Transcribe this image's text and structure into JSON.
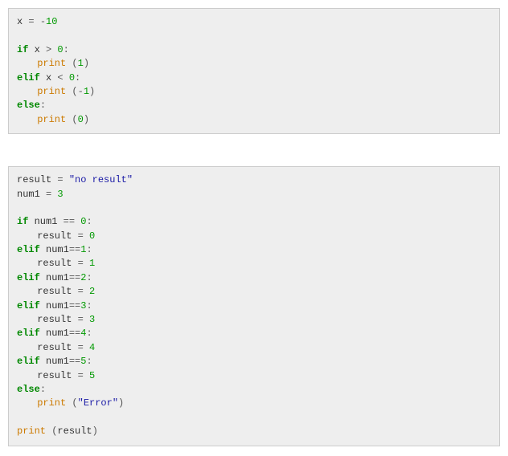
{
  "blocks": [
    {
      "lines": [
        [
          {
            "t": "name",
            "v": "x"
          },
          {
            "t": "txt",
            "v": " "
          },
          {
            "t": "op",
            "v": "="
          },
          {
            "t": "txt",
            "v": " "
          },
          {
            "t": "op",
            "v": "-"
          },
          {
            "t": "num",
            "v": "10"
          }
        ],
        [],
        [
          {
            "t": "kw",
            "v": "if"
          },
          {
            "t": "txt",
            "v": " "
          },
          {
            "t": "name",
            "v": "x"
          },
          {
            "t": "txt",
            "v": " "
          },
          {
            "t": "op",
            "v": ">"
          },
          {
            "t": "txt",
            "v": " "
          },
          {
            "t": "num",
            "v": "0"
          },
          {
            "t": "op",
            "v": ":"
          }
        ],
        [
          {
            "t": "indent"
          },
          {
            "t": "func",
            "v": "print"
          },
          {
            "t": "txt",
            "v": " "
          },
          {
            "t": "op",
            "v": "("
          },
          {
            "t": "num",
            "v": "1"
          },
          {
            "t": "op",
            "v": ")"
          }
        ],
        [
          {
            "t": "kw",
            "v": "elif"
          },
          {
            "t": "txt",
            "v": " "
          },
          {
            "t": "name",
            "v": "x"
          },
          {
            "t": "txt",
            "v": " "
          },
          {
            "t": "op",
            "v": "<"
          },
          {
            "t": "txt",
            "v": " "
          },
          {
            "t": "num",
            "v": "0"
          },
          {
            "t": "op",
            "v": ":"
          }
        ],
        [
          {
            "t": "indent"
          },
          {
            "t": "func",
            "v": "print"
          },
          {
            "t": "txt",
            "v": " "
          },
          {
            "t": "op",
            "v": "("
          },
          {
            "t": "op",
            "v": "-"
          },
          {
            "t": "num",
            "v": "1"
          },
          {
            "t": "op",
            "v": ")"
          }
        ],
        [
          {
            "t": "kw",
            "v": "else"
          },
          {
            "t": "op",
            "v": ":"
          }
        ],
        [
          {
            "t": "indent"
          },
          {
            "t": "func",
            "v": "print"
          },
          {
            "t": "txt",
            "v": " "
          },
          {
            "t": "op",
            "v": "("
          },
          {
            "t": "num",
            "v": "0"
          },
          {
            "t": "op",
            "v": ")"
          }
        ]
      ]
    },
    {
      "lines": [
        [
          {
            "t": "name",
            "v": "result"
          },
          {
            "t": "txt",
            "v": " "
          },
          {
            "t": "op",
            "v": "="
          },
          {
            "t": "txt",
            "v": " "
          },
          {
            "t": "str",
            "v": "\"no result\""
          }
        ],
        [
          {
            "t": "name",
            "v": "num1"
          },
          {
            "t": "txt",
            "v": " "
          },
          {
            "t": "op",
            "v": "="
          },
          {
            "t": "txt",
            "v": " "
          },
          {
            "t": "num",
            "v": "3"
          }
        ],
        [],
        [
          {
            "t": "kw",
            "v": "if"
          },
          {
            "t": "txt",
            "v": " "
          },
          {
            "t": "name",
            "v": "num1"
          },
          {
            "t": "txt",
            "v": " "
          },
          {
            "t": "op",
            "v": "=="
          },
          {
            "t": "txt",
            "v": " "
          },
          {
            "t": "num",
            "v": "0"
          },
          {
            "t": "op",
            "v": ":"
          }
        ],
        [
          {
            "t": "indent"
          },
          {
            "t": "name",
            "v": "result"
          },
          {
            "t": "txt",
            "v": " "
          },
          {
            "t": "op",
            "v": "="
          },
          {
            "t": "txt",
            "v": " "
          },
          {
            "t": "num",
            "v": "0"
          }
        ],
        [
          {
            "t": "kw",
            "v": "elif"
          },
          {
            "t": "txt",
            "v": " "
          },
          {
            "t": "name",
            "v": "num1"
          },
          {
            "t": "op",
            "v": "=="
          },
          {
            "t": "num",
            "v": "1"
          },
          {
            "t": "op",
            "v": ":"
          }
        ],
        [
          {
            "t": "indent"
          },
          {
            "t": "name",
            "v": "result"
          },
          {
            "t": "txt",
            "v": " "
          },
          {
            "t": "op",
            "v": "="
          },
          {
            "t": "txt",
            "v": " "
          },
          {
            "t": "num",
            "v": "1"
          }
        ],
        [
          {
            "t": "kw",
            "v": "elif"
          },
          {
            "t": "txt",
            "v": " "
          },
          {
            "t": "name",
            "v": "num1"
          },
          {
            "t": "op",
            "v": "=="
          },
          {
            "t": "num",
            "v": "2"
          },
          {
            "t": "op",
            "v": ":"
          }
        ],
        [
          {
            "t": "indent"
          },
          {
            "t": "name",
            "v": "result"
          },
          {
            "t": "txt",
            "v": " "
          },
          {
            "t": "op",
            "v": "="
          },
          {
            "t": "txt",
            "v": " "
          },
          {
            "t": "num",
            "v": "2"
          }
        ],
        [
          {
            "t": "kw",
            "v": "elif"
          },
          {
            "t": "txt",
            "v": " "
          },
          {
            "t": "name",
            "v": "num1"
          },
          {
            "t": "op",
            "v": "=="
          },
          {
            "t": "num",
            "v": "3"
          },
          {
            "t": "op",
            "v": ":"
          }
        ],
        [
          {
            "t": "indent"
          },
          {
            "t": "name",
            "v": "result"
          },
          {
            "t": "txt",
            "v": " "
          },
          {
            "t": "op",
            "v": "="
          },
          {
            "t": "txt",
            "v": " "
          },
          {
            "t": "num",
            "v": "3"
          }
        ],
        [
          {
            "t": "kw",
            "v": "elif"
          },
          {
            "t": "txt",
            "v": " "
          },
          {
            "t": "name",
            "v": "num1"
          },
          {
            "t": "op",
            "v": "=="
          },
          {
            "t": "num",
            "v": "4"
          },
          {
            "t": "op",
            "v": ":"
          }
        ],
        [
          {
            "t": "indent"
          },
          {
            "t": "name",
            "v": "result"
          },
          {
            "t": "txt",
            "v": " "
          },
          {
            "t": "op",
            "v": "="
          },
          {
            "t": "txt",
            "v": " "
          },
          {
            "t": "num",
            "v": "4"
          }
        ],
        [
          {
            "t": "kw",
            "v": "elif"
          },
          {
            "t": "txt",
            "v": " "
          },
          {
            "t": "name",
            "v": "num1"
          },
          {
            "t": "op",
            "v": "=="
          },
          {
            "t": "num",
            "v": "5"
          },
          {
            "t": "op",
            "v": ":"
          }
        ],
        [
          {
            "t": "indent"
          },
          {
            "t": "name",
            "v": "result"
          },
          {
            "t": "txt",
            "v": " "
          },
          {
            "t": "op",
            "v": "="
          },
          {
            "t": "txt",
            "v": " "
          },
          {
            "t": "num",
            "v": "5"
          }
        ],
        [
          {
            "t": "kw",
            "v": "else"
          },
          {
            "t": "op",
            "v": ":"
          }
        ],
        [
          {
            "t": "indent"
          },
          {
            "t": "func",
            "v": "print"
          },
          {
            "t": "txt",
            "v": " "
          },
          {
            "t": "op",
            "v": "("
          },
          {
            "t": "str",
            "v": "\"Error\""
          },
          {
            "t": "op",
            "v": ")"
          }
        ],
        [],
        [
          {
            "t": "func",
            "v": "print"
          },
          {
            "t": "txt",
            "v": " "
          },
          {
            "t": "op",
            "v": "("
          },
          {
            "t": "name",
            "v": "result"
          },
          {
            "t": "op",
            "v": ")"
          }
        ]
      ]
    }
  ]
}
